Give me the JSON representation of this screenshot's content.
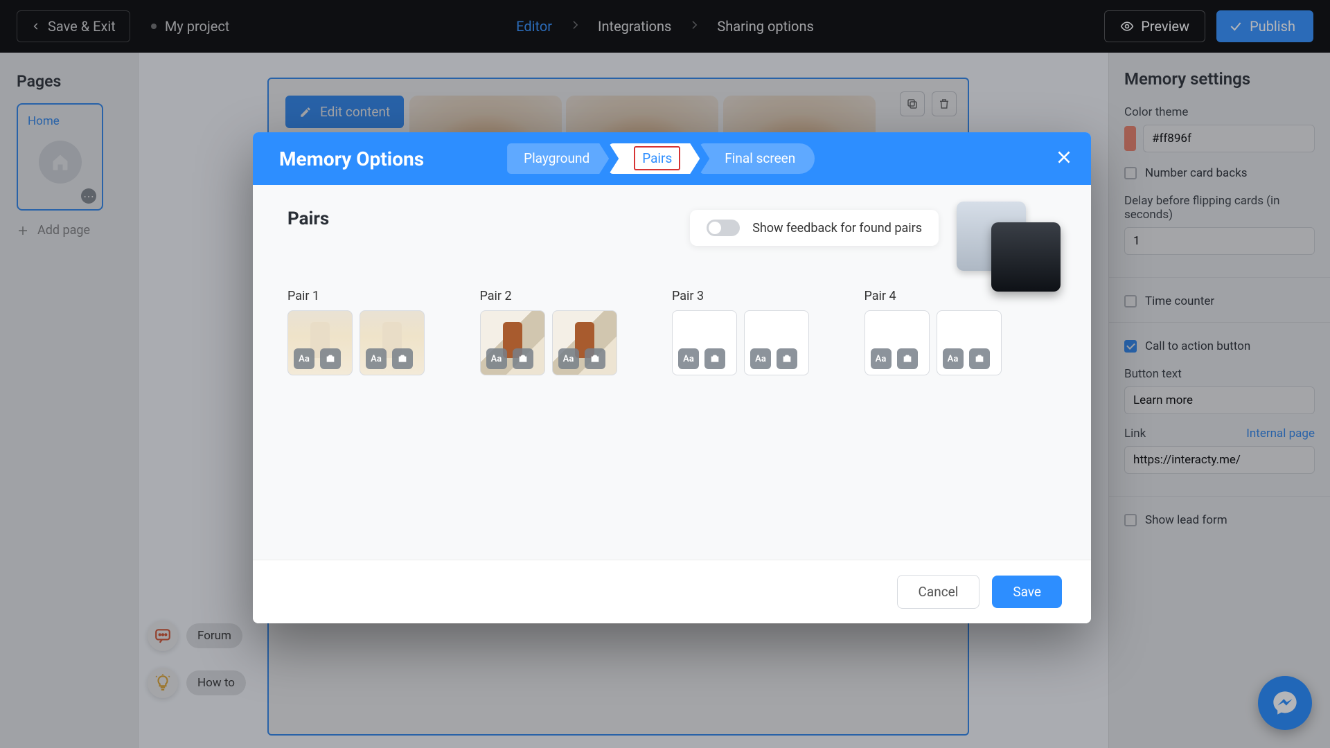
{
  "topbar": {
    "save_exit": "Save & Exit",
    "project_name": "My project",
    "steps": [
      "Editor",
      "Integrations",
      "Sharing options"
    ],
    "active_step_index": 0,
    "preview": "Preview",
    "publish": "Publish"
  },
  "left_panel": {
    "title": "Pages",
    "home_label": "Home",
    "add_page": "Add page"
  },
  "canvas": {
    "edit_content": "Edit content"
  },
  "right_panel": {
    "title": "Memory settings",
    "color_theme_label": "Color theme",
    "color_theme_value": "#ff896f",
    "number_card_backs": "Number card backs",
    "delay_label": "Delay before flipping cards (in seconds)",
    "delay_value": "1",
    "time_counter": "Time counter",
    "cta_label": "Call to action button",
    "button_text_label": "Button text",
    "button_text_value": "Learn more",
    "link_label": "Link",
    "internal_page": "Internal page",
    "link_value": "https://interacty.me/",
    "show_lead_form": "Show lead form"
  },
  "pills": {
    "forum": "Forum",
    "howto": "How to"
  },
  "modal": {
    "title": "Memory Options",
    "tabs": [
      "Playground",
      "Pairs",
      "Final screen"
    ],
    "active_tab_index": 1,
    "section_title": "Pairs",
    "feedback_label": "Show feedback for found pairs",
    "pairs": [
      {
        "label": "Pair 1",
        "has_image": true
      },
      {
        "label": "Pair 2",
        "has_image": true
      },
      {
        "label": "Pair 3",
        "has_image": false
      },
      {
        "label": "Pair 4",
        "has_image": false
      }
    ],
    "card_text_label": "Aa",
    "cancel": "Cancel",
    "save": "Save"
  }
}
